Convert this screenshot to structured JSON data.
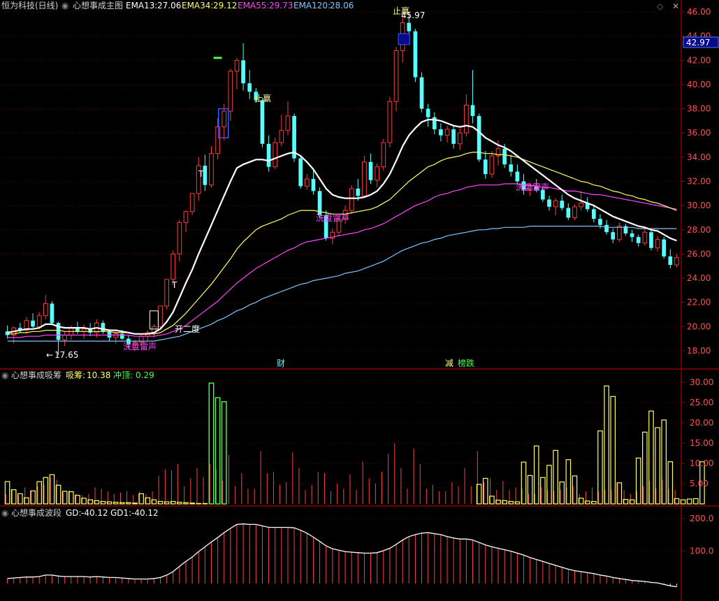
{
  "header": {
    "stock": "恒为科技(日线)",
    "indicator": "心想事成主图",
    "ema13_label": "EMA13:",
    "ema13": "27.06",
    "ema34_label": "EMA34:",
    "ema34": "29.12",
    "ema55_label": "EMA55:",
    "ema55": "29.73",
    "ema120_label": "EMA120:",
    "ema120": "28.06"
  },
  "panel2": {
    "title": "心想事成吸筹",
    "x_label": "吸筹:",
    "x_value": "10.38",
    "c_label": "冲顶:",
    "c_value": "0.29"
  },
  "panel3": {
    "title": "心想事成波段",
    "gd_label": "GD:",
    "gd_value": "-40.12",
    "gd1_label": "GD1:",
    "gd1_value": "-40.12"
  },
  "current_price": "42.97",
  "colors": {
    "up": "#ff3b3b",
    "down": "#54ffff",
    "ema13": "#ffffff",
    "ema34": "#ffff66",
    "ema55": "#ff44ff",
    "ema120": "#7fc4ff",
    "grid": "#8b0000"
  },
  "annotations": {
    "low": "17.65",
    "high": "45.97",
    "wash1": "洗盘雷声",
    "wash2": "洗盘雷声",
    "wash3": "洗盘雷声",
    "open2": "开二度",
    "stop": "止赢",
    "stop2": "止赢",
    "t1": "T",
    "t2": "T",
    "cai": "财",
    "jian": "减",
    "bang": "榜跌"
  },
  "chart_data": [
    {
      "type": "candlestick",
      "title": "心想事成主图",
      "y_ticks": [
        18.0,
        20.0,
        22.0,
        24.0,
        26.0,
        28.0,
        30.0,
        32.0,
        34.0,
        36.0,
        38.0,
        40.0,
        42.0,
        44.0,
        46.0
      ],
      "ylim": [
        17.0,
        47.0
      ],
      "ohlc": [
        [
          19.6,
          20.1,
          19.0,
          19.3
        ],
        [
          19.3,
          20.0,
          18.6,
          19.9
        ],
        [
          19.9,
          20.3,
          19.5,
          19.7
        ],
        [
          19.7,
          20.8,
          19.4,
          20.5
        ],
        [
          20.5,
          21.1,
          19.9,
          20.0
        ],
        [
          20.0,
          21.2,
          19.8,
          20.9
        ],
        [
          20.9,
          22.6,
          20.6,
          21.9
        ],
        [
          21.9,
          22.1,
          20.1,
          20.3
        ],
        [
          20.3,
          20.4,
          17.65,
          18.9
        ],
        [
          18.9,
          19.6,
          18.4,
          19.3
        ],
        [
          19.3,
          20.1,
          18.9,
          19.9
        ],
        [
          19.9,
          20.4,
          19.4,
          19.6
        ],
        [
          19.6,
          20.2,
          19.0,
          19.8
        ],
        [
          19.8,
          20.3,
          19.2,
          19.5
        ],
        [
          19.5,
          20.6,
          19.1,
          20.3
        ],
        [
          20.3,
          20.5,
          19.4,
          19.6
        ],
        [
          19.6,
          19.8,
          18.8,
          19.1
        ],
        [
          19.1,
          19.6,
          18.6,
          19.4
        ],
        [
          19.4,
          19.7,
          18.9,
          19.0
        ],
        [
          19.0,
          19.3,
          18.2,
          18.5
        ],
        [
          18.5,
          18.9,
          18.0,
          18.7
        ],
        [
          18.7,
          19.4,
          18.4,
          19.2
        ],
        [
          19.2,
          19.7,
          18.8,
          19.5
        ],
        [
          19.5,
          20.2,
          19.1,
          20.0
        ],
        [
          20.0,
          21.7,
          19.8,
          21.7
        ],
        [
          21.7,
          23.9,
          21.4,
          23.9
        ],
        [
          23.9,
          26.3,
          23.4,
          26.0
        ],
        [
          26.0,
          28.8,
          25.4,
          28.6
        ],
        [
          28.6,
          29.6,
          27.8,
          29.5
        ],
        [
          29.5,
          31.0,
          29.2,
          31.0
        ],
        [
          31.0,
          34.0,
          30.4,
          33.3
        ],
        [
          33.3,
          34.2,
          31.2,
          31.7
        ],
        [
          31.7,
          34.9,
          31.5,
          34.3
        ],
        [
          34.3,
          37.2,
          33.8,
          36.5
        ],
        [
          36.5,
          38.4,
          35.4,
          37.8
        ],
        [
          37.8,
          41.3,
          37.0,
          41.1
        ],
        [
          41.1,
          42.2,
          39.6,
          42.0
        ],
        [
          42.0,
          43.4,
          39.5,
          40.1
        ],
        [
          40.1,
          41.2,
          38.8,
          39.4
        ],
        [
          39.4,
          39.7,
          38.5,
          38.7
        ],
        [
          38.7,
          38.9,
          34.8,
          35.1
        ],
        [
          35.1,
          35.8,
          32.8,
          33.2
        ],
        [
          33.2,
          35.6,
          33.0,
          35.2
        ],
        [
          35.2,
          37.5,
          34.9,
          36.2
        ],
        [
          36.2,
          38.6,
          35.8,
          37.4
        ],
        [
          37.4,
          37.6,
          33.6,
          33.9
        ],
        [
          33.9,
          34.1,
          31.4,
          31.6
        ],
        [
          31.6,
          32.6,
          31.3,
          32.2
        ],
        [
          32.2,
          33.1,
          30.9,
          31.2
        ],
        [
          31.2,
          31.5,
          29.0,
          29.2
        ],
        [
          29.2,
          29.6,
          27.1,
          27.3
        ],
        [
          27.3,
          28.1,
          26.8,
          27.8
        ],
        [
          27.8,
          29.2,
          27.5,
          28.9
        ],
        [
          28.9,
          30.0,
          28.5,
          29.6
        ],
        [
          29.6,
          31.7,
          29.3,
          31.4
        ],
        [
          31.4,
          32.2,
          30.4,
          30.8
        ],
        [
          30.8,
          34.1,
          30.6,
          33.6
        ],
        [
          33.6,
          34.3,
          31.8,
          32.1
        ],
        [
          32.1,
          33.5,
          31.5,
          33.2
        ],
        [
          33.2,
          35.5,
          32.9,
          35.2
        ],
        [
          35.2,
          39.0,
          34.8,
          38.6
        ],
        [
          38.6,
          43.1,
          37.8,
          42.8
        ],
        [
          42.8,
          45.7,
          41.8,
          45.1
        ],
        [
          45.1,
          45.97,
          43.5,
          44.4
        ],
        [
          44.4,
          44.6,
          40.2,
          40.6
        ],
        [
          40.6,
          41.0,
          37.7,
          38.0
        ],
        [
          38.0,
          38.4,
          36.5,
          37.3
        ],
        [
          37.3,
          37.7,
          35.9,
          36.3
        ],
        [
          36.3,
          36.8,
          35.3,
          35.8
        ],
        [
          35.8,
          36.6,
          35.2,
          36.3
        ],
        [
          36.3,
          36.6,
          34.7,
          35.1
        ],
        [
          35.1,
          36.4,
          34.6,
          36.0
        ],
        [
          36.0,
          39.2,
          35.7,
          38.3
        ],
        [
          38.3,
          41.2,
          36.8,
          37.4
        ],
        [
          37.4,
          37.6,
          33.6,
          33.8
        ],
        [
          33.8,
          34.5,
          32.2,
          32.6
        ],
        [
          32.6,
          34.5,
          32.3,
          34.1
        ],
        [
          34.1,
          35.4,
          33.3,
          34.7
        ],
        [
          34.7,
          35.1,
          33.1,
          33.4
        ],
        [
          33.4,
          34.2,
          32.4,
          32.8
        ],
        [
          32.8,
          33.4,
          31.7,
          32.0
        ],
        [
          32.0,
          32.6,
          30.9,
          31.3
        ],
        [
          31.3,
          31.9,
          30.8,
          31.6
        ],
        [
          31.6,
          32.2,
          31.1,
          31.3
        ],
        [
          31.3,
          31.5,
          30.3,
          30.5
        ],
        [
          30.5,
          30.8,
          29.6,
          29.9
        ],
        [
          29.9,
          30.6,
          29.2,
          30.4
        ],
        [
          30.4,
          30.9,
          29.6,
          29.8
        ],
        [
          29.8,
          30.2,
          28.8,
          29.0
        ],
        [
          29.0,
          30.1,
          28.8,
          29.9
        ],
        [
          29.9,
          31.2,
          29.6,
          30.2
        ],
        [
          30.2,
          30.7,
          29.5,
          29.7
        ],
        [
          29.7,
          30.1,
          28.6,
          28.9
        ],
        [
          28.9,
          29.3,
          28.1,
          28.4
        ],
        [
          28.4,
          28.8,
          27.6,
          27.8
        ],
        [
          27.8,
          28.1,
          26.9,
          27.2
        ],
        [
          27.2,
          28.6,
          27.0,
          28.3
        ],
        [
          28.3,
          28.5,
          27.5,
          27.7
        ],
        [
          27.7,
          28.0,
          27.0,
          27.4
        ],
        [
          27.4,
          27.6,
          26.6,
          26.9
        ],
        [
          26.9,
          28.1,
          26.7,
          27.8
        ],
        [
          27.8,
          28.0,
          26.3,
          26.5
        ],
        [
          26.5,
          27.5,
          26.2,
          27.2
        ],
        [
          27.2,
          27.4,
          25.6,
          25.8
        ],
        [
          25.8,
          26.4,
          24.8,
          25.1
        ],
        [
          25.1,
          26.0,
          24.9,
          25.7
        ]
      ],
      "ema13": [
        19.5,
        19.6,
        19.7,
        19.8,
        19.8,
        19.9,
        20.2,
        20.2,
        20.0,
        19.9,
        19.9,
        19.9,
        19.9,
        19.8,
        19.9,
        19.8,
        19.7,
        19.7,
        19.6,
        19.5,
        19.4,
        19.4,
        19.4,
        19.5,
        19.8,
        20.4,
        21.2,
        22.4,
        23.6,
        24.7,
        26.0,
        27.2,
        28.4,
        29.6,
        30.8,
        32.0,
        33.1,
        33.4,
        33.6,
        33.8,
        33.8,
        33.7,
        33.9,
        34.1,
        34.3,
        34.4,
        34.1,
        33.6,
        33.0,
        32.2,
        31.4,
        30.9,
        30.7,
        30.6,
        30.6,
        30.6,
        30.7,
        30.9,
        31.2,
        31.8,
        32.6,
        33.7,
        34.9,
        35.8,
        36.4,
        36.9,
        37.1,
        37.1,
        37.0,
        36.8,
        36.6,
        36.5,
        36.6,
        36.5,
        36.1,
        35.6,
        35.3,
        35.0,
        34.8,
        34.5,
        34.1,
        33.7,
        33.3,
        32.9,
        32.5,
        32.1,
        31.7,
        31.3,
        30.9,
        30.6,
        30.4,
        30.2,
        30.0,
        29.7,
        29.4,
        29.1,
        28.9,
        28.7,
        28.5,
        28.3,
        28.2,
        28.0,
        27.9,
        27.6,
        27.3,
        27.1
      ],
      "ema34": [
        19.4,
        19.4,
        19.5,
        19.5,
        19.6,
        19.6,
        19.7,
        19.7,
        19.7,
        19.6,
        19.6,
        19.6,
        19.6,
        19.6,
        19.6,
        19.6,
        19.6,
        19.5,
        19.5,
        19.5,
        19.4,
        19.4,
        19.4,
        19.4,
        19.5,
        19.8,
        20.1,
        20.6,
        21.1,
        21.7,
        22.3,
        22.9,
        23.5,
        24.2,
        24.9,
        25.6,
        26.4,
        27.0,
        27.5,
        28.0,
        28.3,
        28.5,
        28.7,
        28.9,
        29.2,
        29.4,
        29.6,
        29.6,
        29.6,
        29.5,
        29.4,
        29.3,
        29.3,
        29.3,
        29.4,
        29.5,
        29.6,
        29.7,
        29.9,
        30.2,
        30.5,
        31.0,
        31.5,
        32.0,
        32.4,
        32.8,
        33.2,
        33.4,
        33.7,
        33.9,
        34.0,
        34.1,
        34.3,
        34.4,
        34.4,
        34.3,
        34.3,
        34.2,
        34.2,
        34.1,
        34.0,
        33.8,
        33.6,
        33.4,
        33.2,
        33.0,
        32.8,
        32.6,
        32.4,
        32.2,
        32.0,
        31.9,
        31.7,
        31.6,
        31.4,
        31.2,
        31.1,
        30.9,
        30.8,
        30.6,
        30.5,
        30.3,
        30.2,
        30.0,
        29.8,
        29.6
      ],
      "ema55": [
        19.1,
        19.1,
        19.1,
        19.2,
        19.2,
        19.2,
        19.3,
        19.3,
        19.3,
        19.3,
        19.3,
        19.3,
        19.3,
        19.3,
        19.3,
        19.3,
        19.3,
        19.3,
        19.3,
        19.3,
        19.2,
        19.2,
        19.2,
        19.2,
        19.3,
        19.4,
        19.6,
        19.8,
        20.1,
        20.5,
        20.9,
        21.3,
        21.7,
        22.1,
        22.6,
        23.1,
        23.6,
        24.0,
        24.4,
        24.8,
        25.1,
        25.4,
        25.7,
        26.0,
        26.3,
        26.5,
        26.8,
        27.0,
        27.1,
        27.2,
        27.3,
        27.4,
        27.5,
        27.6,
        27.7,
        27.8,
        28.0,
        28.1,
        28.3,
        28.5,
        28.8,
        29.1,
        29.4,
        29.7,
        30.0,
        30.2,
        30.4,
        30.7,
        30.9,
        31.0,
        31.2,
        31.3,
        31.5,
        31.6,
        31.7,
        31.7,
        31.7,
        31.7,
        31.8,
        31.8,
        31.8,
        31.7,
        31.7,
        31.6,
        31.5,
        31.5,
        31.4,
        31.3,
        31.2,
        31.2,
        31.1,
        31.0,
        30.9,
        30.9,
        30.8,
        30.7,
        30.6,
        30.5,
        30.4,
        30.3,
        30.2,
        30.1,
        30.0,
        29.9,
        29.8,
        29.7
      ],
      "ema120": [
        18.8,
        18.8,
        18.8,
        18.8,
        18.8,
        18.8,
        18.8,
        18.8,
        18.8,
        18.8,
        18.8,
        18.8,
        18.8,
        18.8,
        18.8,
        18.8,
        18.8,
        18.8,
        18.8,
        18.8,
        18.8,
        18.8,
        18.8,
        18.8,
        18.9,
        19.0,
        19.1,
        19.2,
        19.4,
        19.6,
        19.8,
        20.0,
        20.2,
        20.5,
        20.7,
        21.0,
        21.3,
        21.5,
        21.8,
        22.0,
        22.3,
        22.5,
        22.7,
        22.9,
        23.1,
        23.3,
        23.5,
        23.6,
        23.8,
        23.9,
        24.0,
        24.1,
        24.2,
        24.4,
        24.5,
        24.6,
        24.8,
        25.0,
        25.2,
        25.4,
        25.7,
        26.0,
        26.3,
        26.5,
        26.7,
        26.9,
        27.0,
        27.2,
        27.3,
        27.5,
        27.6,
        27.7,
        27.8,
        27.9,
        28.0,
        28.0,
        28.1,
        28.1,
        28.2,
        28.2,
        28.2,
        28.2,
        28.3,
        28.3,
        28.3,
        28.3,
        28.3,
        28.3,
        28.3,
        28.3,
        28.3,
        28.3,
        28.3,
        28.3,
        28.2,
        28.2,
        28.2,
        28.2,
        28.2,
        28.1,
        28.1,
        28.1,
        28.1,
        28.1,
        28.1,
        28.1
      ]
    },
    {
      "type": "bar",
      "title": "心想事成吸筹",
      "y_ticks": [
        5.0,
        10.0,
        15.0,
        20.0,
        25.0,
        30.0
      ],
      "ylim": [
        0,
        31.5
      ],
      "series": [
        {
          "name": "吸筹",
          "values": [
            5.5,
            3.5,
            2.5,
            1.5,
            3.2,
            5.5,
            6.5,
            7.2,
            4.6,
            3.1,
            3.0,
            2.1,
            1.4,
            1.0,
            0.8,
            0.6,
            0.5,
            0.4,
            0.3,
            0.3,
            0.2,
            2.5,
            1.5,
            1.0,
            0.6,
            0.5,
            0.6,
            0.4,
            0.3,
            0.2,
            0.1,
            0.1,
            0,
            0,
            0,
            0,
            0,
            0,
            0,
            0,
            0,
            0,
            0,
            0,
            0,
            0,
            0,
            0,
            0,
            0,
            0,
            0,
            0,
            0,
            0,
            0,
            0,
            0,
            0,
            0,
            0,
            0,
            0,
            0,
            0,
            0,
            0,
            0,
            0,
            0,
            0,
            0,
            0,
            0,
            4.8,
            6.3,
            1.9,
            0.9,
            0.8,
            0.6,
            0.5,
            10.3,
            7.0,
            14.3,
            6.5,
            9.5,
            13.2,
            5.4,
            10.9,
            6.9,
            1.4,
            0.7,
            0.6,
            18.0,
            29.1,
            26.5,
            5.2,
            1.1,
            1.0,
            11.3,
            17.7,
            22.9,
            18.8,
            20.7,
            10.4,
            1.3,
            1.0,
            1.2,
            1.3,
            10.38
          ],
          "_note": "yellow outlined bars"
        }
      ]
    },
    {
      "type": "bar",
      "title": "心想事成波段",
      "y_ticks": [
        100.0,
        200.0
      ],
      "ylim": [
        -40,
        210
      ]
    }
  ]
}
